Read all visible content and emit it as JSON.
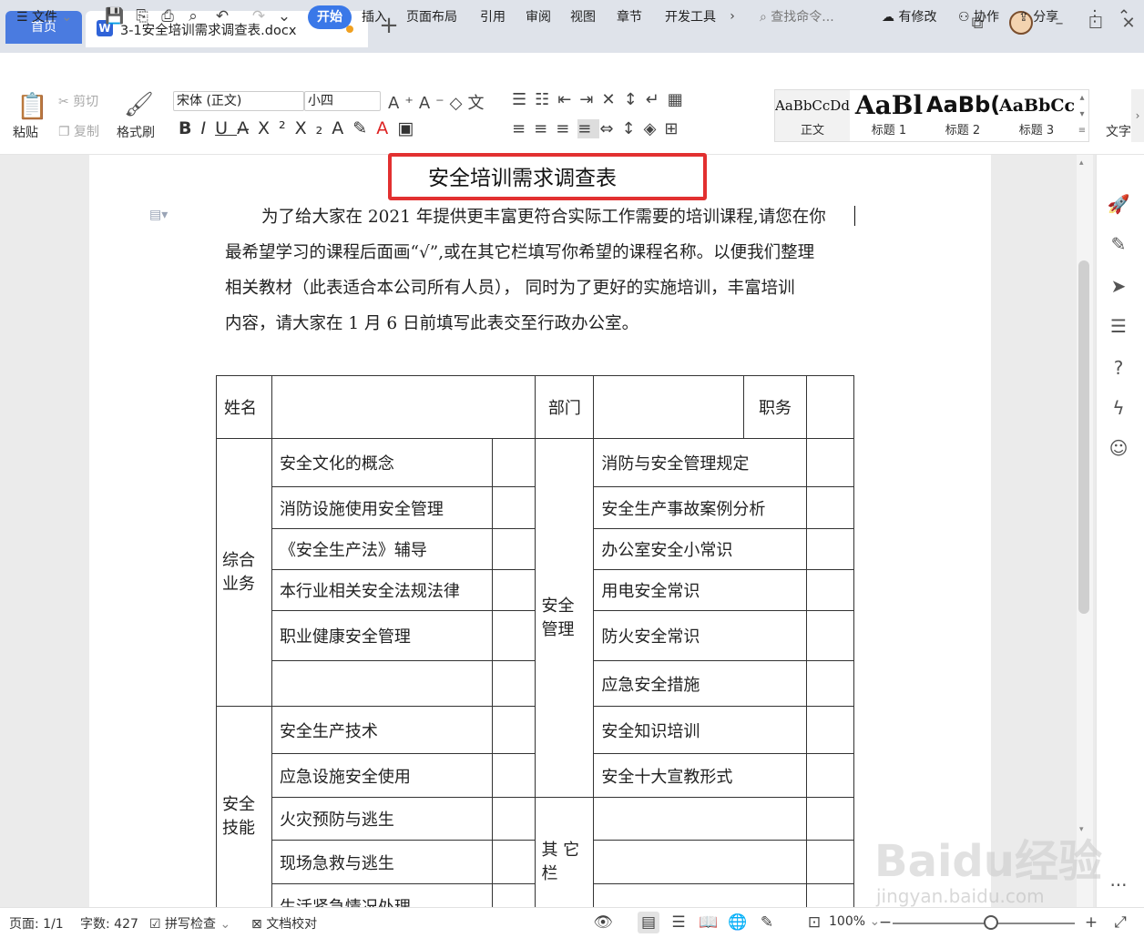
{
  "tabs": {
    "home": "首页",
    "doc": "3-1安全培训需求调查表.docx",
    "new_tab": "+"
  },
  "menu": {
    "file": "文件",
    "items": [
      "开始",
      "插入",
      "页面布局",
      "引用",
      "审阅",
      "视图",
      "章节",
      "开发工具"
    ],
    "search": "查找命令...",
    "changes": "有修改",
    "collab": "协作",
    "share": "分享"
  },
  "ribbon": {
    "paste": "粘贴",
    "cut": "剪切",
    "copy": "复制",
    "format_painter": "格式刷",
    "font_name": "宋体 (正文)",
    "font_size": "小四",
    "styles": [
      {
        "preview": "AaBbCcDd",
        "label": "正文"
      },
      {
        "preview": "AaBl",
        "label": "标题 1"
      },
      {
        "preview": "AaBb(",
        "label": "标题 2"
      },
      {
        "preview": "AaBbCcI",
        "label": "标题 3"
      }
    ],
    "text_tool": "文字"
  },
  "document": {
    "title": "安全培训需求调查表",
    "paragraph": [
      "为了给大家在 2021 年提供更丰富更符合实际工作需要的培训课程,请您在你",
      "最希望学习的课程后面画“√”,或在其它栏填写你希望的课程名称。以便我们整理",
      "相关教材（此表适合本公司所有人员），   同时为了更好的实施培训，丰富培训",
      "内容，请大家在 1 月 6 日前填写此表交至行政办公室。"
    ],
    "table": {
      "header": {
        "name": "姓名",
        "dept": "部门",
        "position": "职务"
      },
      "categories": {
        "general": "综合业务",
        "skills": "安全技能",
        "management": "安全管理",
        "other": "其 它栏"
      },
      "left_rows": [
        "安全文化的概念",
        "消防设施使用安全管理",
        "《安全生产法》辅导",
        "本行业相关安全法规法律",
        "职业健康安全管理",
        "",
        "安全生产技术",
        "应急设施安全使用",
        "火灾预防与逃生",
        "现场急救与逃生",
        "生活紧急情况处理"
      ],
      "right_rows": [
        "消防与安全管理规定",
        "安全生产事故案例分析",
        "办公室安全小常识",
        "用电安全常识",
        "防火安全常识",
        "应急安全措施",
        "安全知识培训",
        "安全十大宣教形式"
      ]
    }
  },
  "status": {
    "page": "页面: 1/1",
    "words": "字数: 427",
    "spell": "拼写检查",
    "proof": "文档校对",
    "zoom": "100%"
  },
  "watermark": {
    "main": "Baidu经验",
    "sub": "jingyan.baidu.com"
  },
  "colors": {
    "accent": "#3a78e8",
    "home_tab": "#4a7be0",
    "highlight_box": "#e23030"
  }
}
